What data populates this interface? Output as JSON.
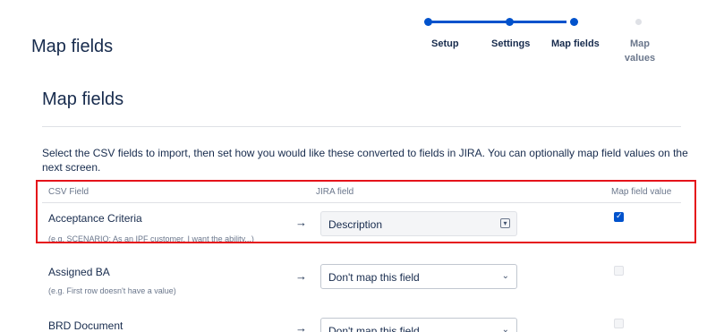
{
  "page": {
    "title": "Map fields"
  },
  "stepper": {
    "steps": [
      {
        "label": "Setup",
        "state": "complete"
      },
      {
        "label": "Settings",
        "state": "complete"
      },
      {
        "label": "Map fields",
        "state": "current"
      },
      {
        "label": "Map values",
        "state": "pending"
      }
    ]
  },
  "section": {
    "title": "Map fields",
    "intro": "Select the CSV fields to import, then set how you would like these converted to fields in JIRA. You can optionally map field values on the next screen."
  },
  "table": {
    "headers": {
      "csv_field": "CSV Field",
      "jira_field": "JIRA field",
      "map_value": "Map field value"
    },
    "rows": [
      {
        "name": "Acceptance Criteria",
        "example": "(e.g. SCENARIO: As an IPF customer, I want the ability...)",
        "arrow": "→",
        "jira_field": "Description",
        "map_value": true
      },
      {
        "name": "Assigned BA",
        "example": "(e.g. First row doesn't have a value)",
        "arrow": "→",
        "jira_field": "Don't map this field",
        "map_value": false
      },
      {
        "name": "BRD Document",
        "example": "",
        "arrow": "→",
        "jira_field": "Don't map this field",
        "map_value": false
      }
    ]
  },
  "colors": {
    "accent": "#0052cc",
    "highlight": "#e5131a"
  },
  "icons": {
    "caret": "chevron-down-icon",
    "select_indicator": "select-box-icon",
    "check": "checkmark-icon"
  }
}
